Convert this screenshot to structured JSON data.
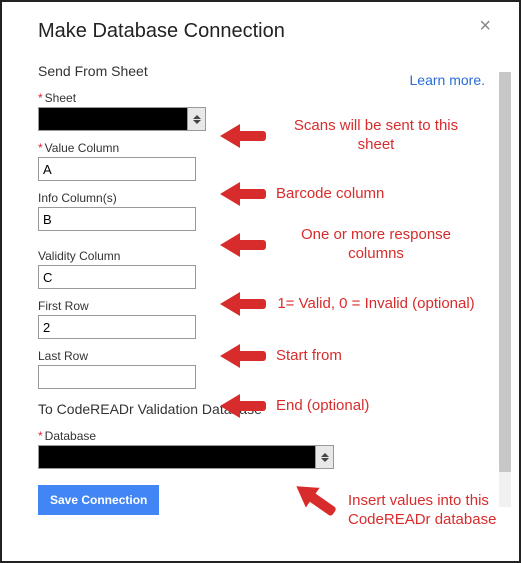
{
  "dialog": {
    "title": "Make Database Connection",
    "learn_more": "Learn more.",
    "section_from": "Send From Sheet",
    "section_to": "To CodeREADr Validation Database",
    "save_button": "Save Connection"
  },
  "fields": {
    "sheet": {
      "label": "Sheet",
      "required": true,
      "value": ""
    },
    "value_column": {
      "label": "Value Column",
      "required": true,
      "value": "A"
    },
    "info_columns": {
      "label": "Info Column(s)",
      "required": false,
      "value": "B"
    },
    "validity_column": {
      "label": "Validity Column",
      "required": false,
      "value": "C"
    },
    "first_row": {
      "label": "First Row",
      "required": false,
      "value": "2"
    },
    "last_row": {
      "label": "Last Row",
      "required": false,
      "value": ""
    },
    "database": {
      "label": "Database",
      "required": true,
      "value": ""
    }
  },
  "annotations": {
    "sheet": "Scans will be sent to this sheet",
    "value_column": "Barcode column",
    "info_columns": "One or more response columns",
    "validity_column": "1= Valid, 0 = Invalid (optional)",
    "first_row": "Start from",
    "last_row": "End (optional)",
    "database": "Insert values into this CodeREADr database"
  }
}
